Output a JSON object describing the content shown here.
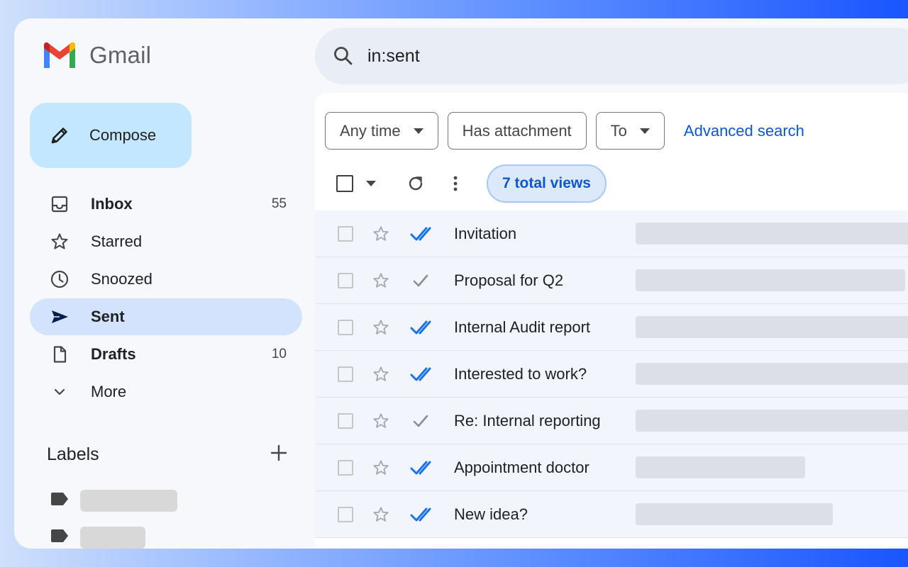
{
  "app": {
    "name": "Gmail"
  },
  "compose": {
    "label": "Compose"
  },
  "nav": [
    {
      "label": "Inbox",
      "count": "55",
      "bold": true,
      "active": false,
      "icon": "inbox-icon"
    },
    {
      "label": "Starred",
      "count": "",
      "bold": false,
      "active": false,
      "icon": "star-icon"
    },
    {
      "label": "Snoozed",
      "count": "",
      "bold": false,
      "active": false,
      "icon": "clock-icon"
    },
    {
      "label": "Sent",
      "count": "",
      "bold": true,
      "active": true,
      "icon": "send-icon"
    },
    {
      "label": "Drafts",
      "count": "10",
      "bold": true,
      "active": false,
      "icon": "draft-icon"
    },
    {
      "label": "More",
      "count": "",
      "bold": false,
      "active": false,
      "icon": "chevron-down-icon"
    }
  ],
  "labels": {
    "title": "Labels"
  },
  "search": {
    "query": "in:sent"
  },
  "filters": {
    "any_time": "Any time",
    "has_attachment": "Has attachment",
    "to": "To",
    "advanced": "Advanced search"
  },
  "toolbar": {
    "views_badge": "7 total views"
  },
  "emails": [
    {
      "subject": "Invitation",
      "status": "read"
    },
    {
      "subject": "Proposal for Q2",
      "status": "sent"
    },
    {
      "subject": "Internal Audit report",
      "status": "read"
    },
    {
      "subject": "Interested to work?",
      "status": "read"
    },
    {
      "subject": "Re: Internal reporting",
      "status": "sent"
    },
    {
      "subject": "Appointment doctor",
      "status": "read"
    },
    {
      "subject": "New idea?",
      "status": "read"
    }
  ],
  "colors": {
    "accent": "#0b57d0",
    "compose_bg": "#c2e7ff",
    "active_nav_bg": "#d3e3fd",
    "read_tick": "#1a73e8",
    "sent_tick": "#8a8d91"
  }
}
